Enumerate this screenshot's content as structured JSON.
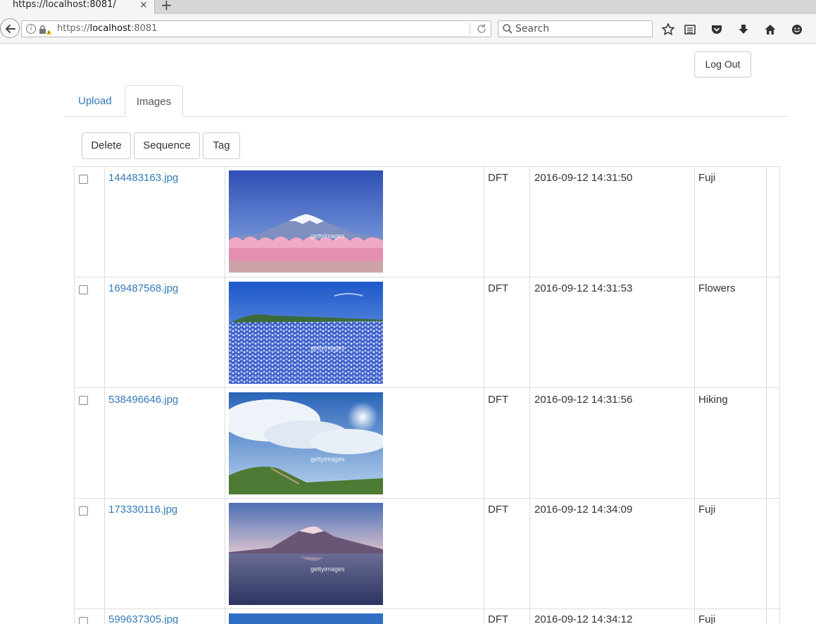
{
  "browser": {
    "tab_title": "https://localhost:8081/",
    "tab_close": "×",
    "new_tab": "+",
    "url_scheme": "https://",
    "url_host": "localhost",
    "url_port": ":8081",
    "search_placeholder": "Search"
  },
  "header": {
    "logout_label": "Log Out"
  },
  "tabs": [
    {
      "label": "Upload",
      "active": false
    },
    {
      "label": "Images",
      "active": true
    }
  ],
  "actions": {
    "delete": "Delete",
    "sequence": "Sequence",
    "tag": "Tag"
  },
  "rows": [
    {
      "filename": "144483163.jpg",
      "status": "DFT",
      "date": "2016-09-12 14:31:50",
      "tag": "Fuji",
      "image": "fuji-cherry-blossoms"
    },
    {
      "filename": "169487568.jpg",
      "status": "DFT",
      "date": "2016-09-12 14:31:53",
      "tag": "Flowers",
      "image": "blue-flower-field"
    },
    {
      "filename": "538496646.jpg",
      "status": "DFT",
      "date": "2016-09-12 14:31:56",
      "tag": "Hiking",
      "image": "mountain-ridge-clouds"
    },
    {
      "filename": "173330116.jpg",
      "status": "DFT",
      "date": "2016-09-12 14:34:09",
      "tag": "Fuji",
      "image": "fuji-lake-reflection"
    },
    {
      "filename": "599637305.jpg",
      "status": "DFT",
      "date": "2016-09-12 14:34:12",
      "tag": "Fuji",
      "image": "fuji-partial"
    }
  ],
  "watermark": "gettyimages",
  "colors": {
    "link": "#337ab7",
    "border": "#dddddd"
  }
}
